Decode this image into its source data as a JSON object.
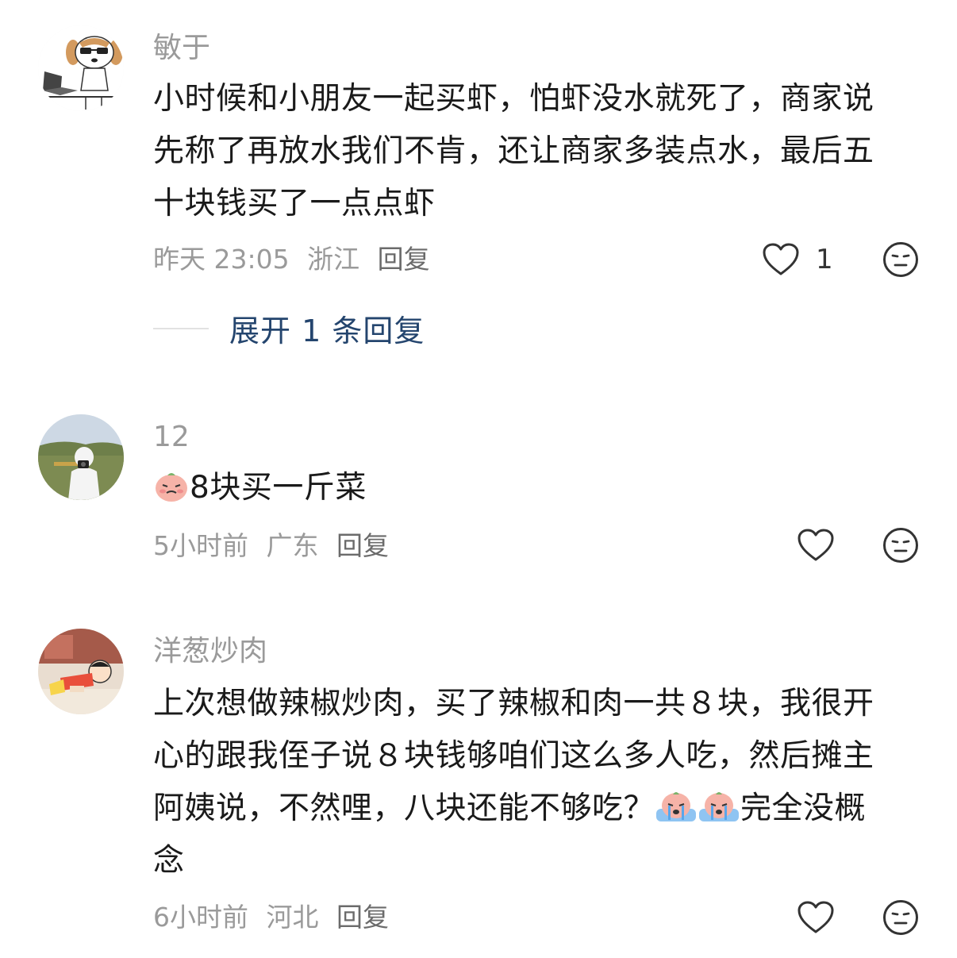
{
  "comments": [
    {
      "username": "敏于",
      "lines": [
        "小时候和小朋友一起买虾，怕虾没水就死了，商家说",
        "先称了再放水我们不肯，还让商家多装点水，最后五",
        "十块钱买了一点点虾"
      ],
      "time": "昨天 23:05",
      "location": "浙江",
      "reply_label": "回复",
      "like_count": "1",
      "expand_label": "展开 1 条回复"
    },
    {
      "username": "12",
      "line_text": "8块买一斤菜",
      "time": "5小时前",
      "location": "广东",
      "reply_label": "回复"
    },
    {
      "username": "洋葱炒肉",
      "lines": [
        "上次想做辣椒炒肉，买了辣椒和肉一共８块，我很开",
        "心的跟我侄子说８块钱够咱们这么多人吃，然后摊主"
      ],
      "line3_before": "阿姨说，不然哩，八块还能不够吃？",
      "line3_after": "完全没概",
      "line4": "念",
      "time": "6小时前",
      "location": "河北",
      "reply_label": "回复"
    }
  ]
}
